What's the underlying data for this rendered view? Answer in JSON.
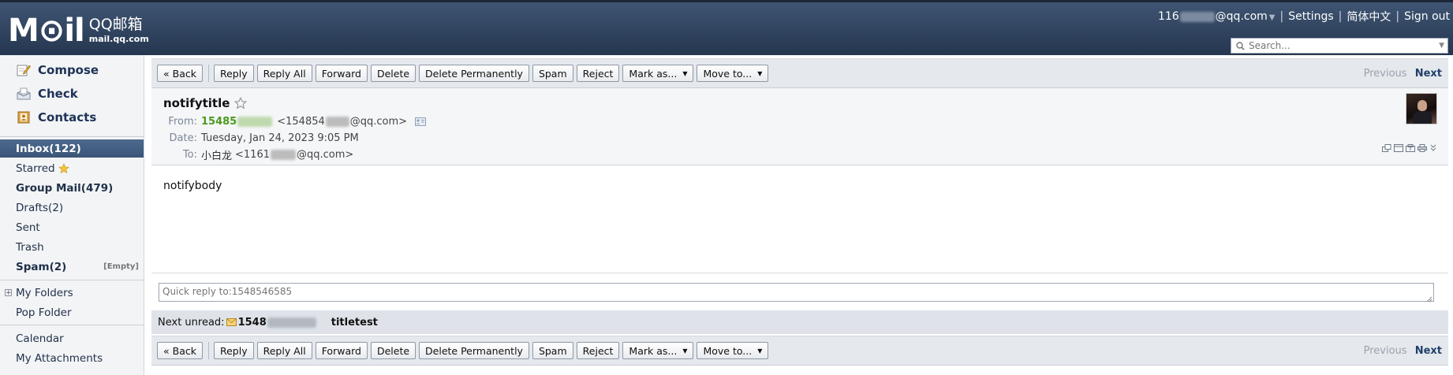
{
  "header": {
    "logo_text": "M⊙il",
    "logo_cn": "QQ邮箱",
    "logo_url": "mail.qq.com",
    "account_prefix": "116",
    "account_suffix": "@qq.com",
    "links": [
      "Settings",
      "简体中文",
      "Sign out"
    ],
    "search_placeholder": "Search..."
  },
  "sidebar": {
    "actions": [
      {
        "label": "Compose",
        "icon": "compose-icon"
      },
      {
        "label": "Check",
        "icon": "check-mail-icon"
      },
      {
        "label": "Contacts",
        "icon": "contacts-icon"
      }
    ],
    "folders": [
      {
        "label": "Inbox(122)",
        "style": "active"
      },
      {
        "label": "Starred",
        "style": "normal",
        "icon": "star-icon"
      },
      {
        "label": "Group Mail(479)",
        "style": "bold"
      },
      {
        "label": "Drafts(2)",
        "style": "normal"
      },
      {
        "label": "Sent",
        "style": "normal"
      },
      {
        "label": "Trash",
        "style": "normal"
      },
      {
        "label": "Spam(2)",
        "style": "bold",
        "extra": "[Empty]"
      }
    ],
    "my_folders": "My Folders",
    "pop_folder": "Pop Folder",
    "calendar": "Calendar",
    "attachments": "My Attachments"
  },
  "toolbar": {
    "back": "« Back",
    "reply": "Reply",
    "reply_all": "Reply All",
    "forward": "Forward",
    "delete": "Delete",
    "delete_perm": "Delete Permanently",
    "spam": "Spam",
    "reject": "Reject",
    "mark_as": "Mark as...",
    "move_to": "Move to...",
    "previous": "Previous",
    "next": "Next"
  },
  "message": {
    "subject": "notifytitle",
    "from_label": "From:",
    "from_name_prefix": "15485",
    "from_addr_prefix": "<154854",
    "from_addr_suffix": "@qq.com>",
    "date_label": "Date:",
    "date": "Tuesday, Jan 24, 2023 9:05 PM",
    "to_label": "To:",
    "to_name": "小白龙",
    "to_addr_prefix": "<1161",
    "to_addr_suffix": "@qq.com>",
    "body": "notifybody"
  },
  "quick_reply": {
    "placeholder": "Quick reply to:1548546585"
  },
  "next_unread": {
    "label": "Next unread:",
    "sender_prefix": "1548",
    "subject": "titletest"
  }
}
